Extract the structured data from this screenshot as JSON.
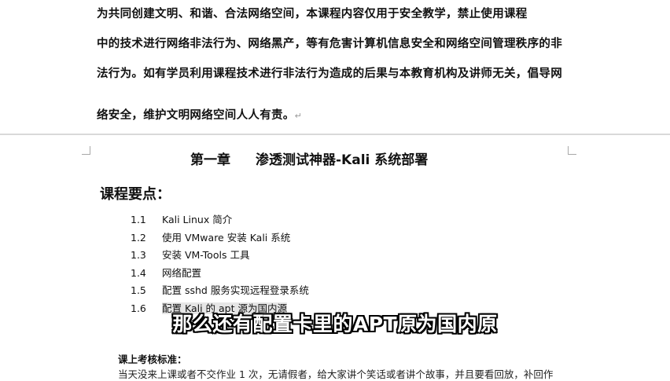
{
  "intro_paragraph": {
    "lines": [
      "为共同创建文明、和谐、合法网络空间，本课程内容仅用于安全教学，禁止使用课程",
      "中的技术进行网络非法行为、网络黑产，等有危害计算机信息安全和网络空间管理秩序的非",
      "法行为。如有学员利用课程技术进行非法行为造成的后果与本教育机构及讲师无关，倡导网",
      "络安全，维护文明网络空间人人有责。"
    ]
  },
  "chapter": {
    "number": "第一章",
    "title": "渗透测试神器-Kali 系统部署"
  },
  "key_points_heading": "课程要点：",
  "key_points": [
    {
      "num": "1.1",
      "text": "Kali Linux 简介"
    },
    {
      "num": "1.2",
      "text": "使用 VMware 安装 Kali 系统"
    },
    {
      "num": "1.3",
      "text": "安装 VM-Tools 工具"
    },
    {
      "num": "1.4",
      "text": "网络配置"
    },
    {
      "num": "1.5",
      "text": "配置 sshd 服务实现远程登录系统"
    },
    {
      "num": "1.6",
      "text": "配置 Kali 的 apt 源为国内源"
    }
  ],
  "exam_heading": "课上考核标准：",
  "cut_line": "当天没来上课或者不交作业 1 次，无请假者，给大家讲个笑话或者讲个故事，并且要看回放，补回作",
  "subtitle": "那么还有配置卡里的APT原为国内原"
}
